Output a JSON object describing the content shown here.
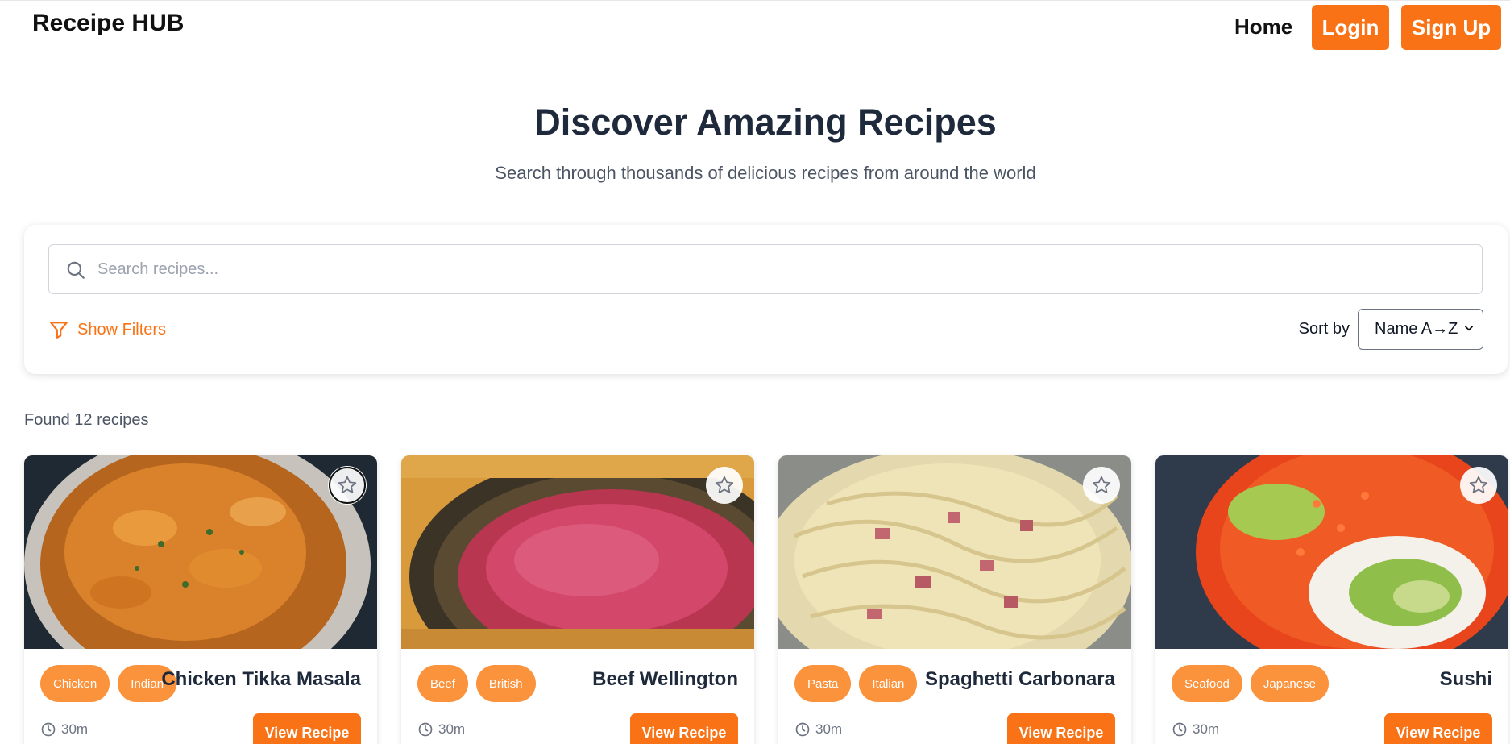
{
  "header": {
    "logo": "Receipe HUB",
    "nav": {
      "home": "Home",
      "login": "Login",
      "signup": "Sign Up"
    }
  },
  "hero": {
    "title": "Discover Amazing Recipes",
    "subtitle": "Search through thousands of delicious recipes from around the world"
  },
  "search": {
    "placeholder": "Search recipes...",
    "value": "",
    "show_filters": "Show Filters",
    "sort_label": "Sort by",
    "sort_value": "Name A→Z"
  },
  "results": {
    "found_text": "Found 12 recipes"
  },
  "recipes": [
    {
      "title": "Chicken Tikka Masala",
      "tags": [
        "Chicken",
        "Indian"
      ],
      "time": "30m",
      "button": "View Recipe"
    },
    {
      "title": "Beef Wellington",
      "tags": [
        "Beef",
        "British"
      ],
      "time": "30m",
      "button": "View Recipe"
    },
    {
      "title": "Spaghetti Carbonara",
      "tags": [
        "Pasta",
        "Italian"
      ],
      "time": "30m",
      "button": "View Recipe"
    },
    {
      "title": "Sushi",
      "tags": [
        "Seafood",
        "Japanese"
      ],
      "time": "30m",
      "button": "View Recipe"
    }
  ],
  "colors": {
    "accent": "#f97316",
    "tag": "#fb923c",
    "heading": "#1e293b"
  },
  "icons": {
    "search": "search-icon",
    "filter": "filter-icon",
    "favorite": "star-icon",
    "time": "clock-icon"
  }
}
